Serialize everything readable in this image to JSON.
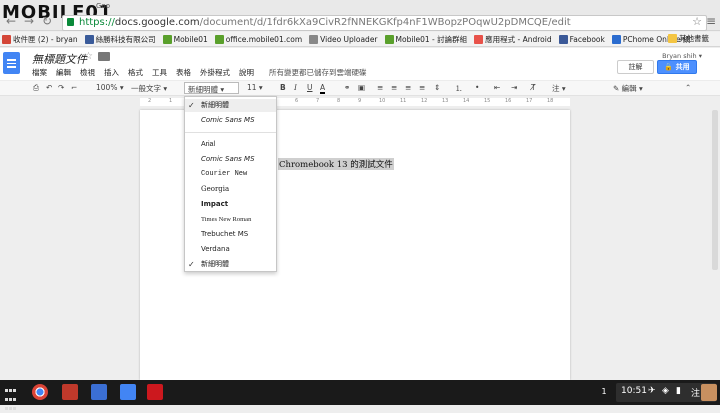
{
  "watermark": "MOBILE01",
  "browser": {
    "tab_partial": "Goo",
    "url_scheme": "https://",
    "url_host": "docs.google.com",
    "url_path": "/document/d/1fdr6kXa9CivR2fNNEKGKfp4nF1WBopzPOqwU2pDMCQE/edit"
  },
  "bookmarks": [
    {
      "label": "收件匣 (2) - bryan",
      "color": "#d44638"
    },
    {
      "label": "絲勝科技有限公司",
      "color": "#3a5b9a"
    },
    {
      "label": "Mobile01",
      "color": "#5aa02c"
    },
    {
      "label": "office.mobile01.com",
      "color": "#5aa02c"
    },
    {
      "label": "Video Uploader",
      "color": "#888888"
    },
    {
      "label": "Mobile01 - 討論群組",
      "color": "#5aa02c"
    },
    {
      "label": "應用程式 - Android",
      "color": "#e8524a"
    },
    {
      "label": "Facebook",
      "color": "#3b5998"
    },
    {
      "label": "PChome Online 網",
      "color": "#2b6ccf"
    }
  ],
  "bookmarks_other": "其他書籤",
  "docs": {
    "title": "無標題文件",
    "menus": [
      "檔案",
      "編輯",
      "檢視",
      "插入",
      "格式",
      "工具",
      "表格",
      "外掛程式",
      "說明"
    ],
    "saved_status": "所有變更都已儲存到雲端硬碟",
    "user": "Bryan shih",
    "comment_button": "註解",
    "share_button": "共用"
  },
  "toolbar": {
    "zoom": "100%",
    "style": "一般文字",
    "font": "新細明體",
    "size": "11",
    "bold": "B",
    "italic": "I",
    "underline": "U",
    "text_color": "A",
    "ime_label": "注",
    "edit_mode": "編輯"
  },
  "ruler_ticks": [
    "2",
    "1",
    "1",
    "2",
    "3",
    "4",
    "5",
    "6",
    "7",
    "8",
    "9",
    "10",
    "11",
    "12",
    "13",
    "14",
    "15",
    "16",
    "17",
    "18"
  ],
  "document": {
    "text": "Chromebook 13 的測試文件"
  },
  "font_menu": {
    "recent": [
      "新細明體",
      "Comic Sans MS"
    ],
    "all": [
      "Arial",
      "Comic Sans MS",
      "Courier New",
      "Georgia",
      "Impact",
      "Times New Roman",
      "Trebuchet MS",
      "Verdana",
      "新細明體"
    ],
    "checked": "新細明體"
  },
  "shelf": {
    "notification_count": "1",
    "time": "10:51",
    "ime": "注"
  }
}
